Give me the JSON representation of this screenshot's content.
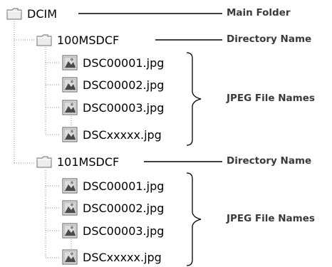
{
  "tree": {
    "root": {
      "label": "DCIM",
      "icon": "folder-icon"
    },
    "folders": [
      {
        "label": "100MSDCF",
        "icon": "folder-icon",
        "files": [
          {
            "label": "DSC00001.jpg",
            "icon": "jpeg-file-icon"
          },
          {
            "label": "DSC00002.jpg",
            "icon": "jpeg-file-icon"
          },
          {
            "label": "DSC00003.jpg",
            "icon": "jpeg-file-icon"
          },
          {
            "label": "DSCxxxxx.jpg",
            "icon": "jpeg-file-icon"
          }
        ]
      },
      {
        "label": "101MSDCF",
        "icon": "folder-icon",
        "files": [
          {
            "label": "DSC00001.jpg",
            "icon": "jpeg-file-icon"
          },
          {
            "label": "DSC00002.jpg",
            "icon": "jpeg-file-icon"
          },
          {
            "label": "DSC00003.jpg",
            "icon": "jpeg-file-icon"
          },
          {
            "label": "DSCxxxxx.jpg",
            "icon": "jpeg-file-icon"
          }
        ]
      }
    ]
  },
  "annotations": {
    "main_folder": "Main Folder",
    "directory_name_1": "Directory Name",
    "jpeg_file_names_1": "JPEG File Names",
    "directory_name_2": "Directory Name",
    "jpeg_file_names_2": "JPEG File Names"
  },
  "colors": {
    "folder_fill": "#ececec",
    "folder_stroke": "#6f6f6f",
    "tree_line": "#8a8a8a",
    "leader_line": "#000000",
    "annotation_text": "#3a3a3a"
  }
}
